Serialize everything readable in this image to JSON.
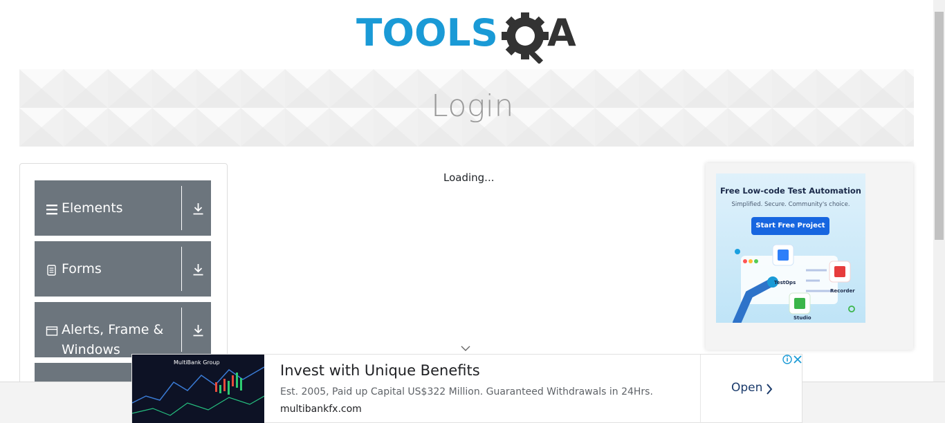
{
  "logo": {
    "text_part": "TOOLS",
    "qa_part": "QA"
  },
  "banner": {
    "title": "Login"
  },
  "sidebar": {
    "groups": [
      {
        "label": "Elements",
        "icon": "hamburger-icon"
      },
      {
        "label": "Forms",
        "icon": "document-icon"
      },
      {
        "label": "Alerts, Frame & Windows",
        "icon": "window-icon"
      }
    ]
  },
  "main": {
    "loading_text": "Loading..."
  },
  "right_ad": {
    "headline": "Free Low-code Test Automation",
    "subline": "Simplified. Secure. Community's choice.",
    "cta": "Start Free Project",
    "products": [
      "TestOps",
      "Recorder",
      "Studio"
    ]
  },
  "bottom_ad": {
    "brand": "MultiBank Group",
    "title": "Invest with Unique Benefits",
    "description": "Est. 2005, Paid up Capital US$322 Million. Guaranteed Withdrawals in 24Hrs.",
    "url": "multibankfx.com",
    "open_label": "Open"
  },
  "colors": {
    "accent_blue": "#1a9ad6",
    "sidebar_gray": "#6c757d",
    "dark_gray": "#333333"
  }
}
